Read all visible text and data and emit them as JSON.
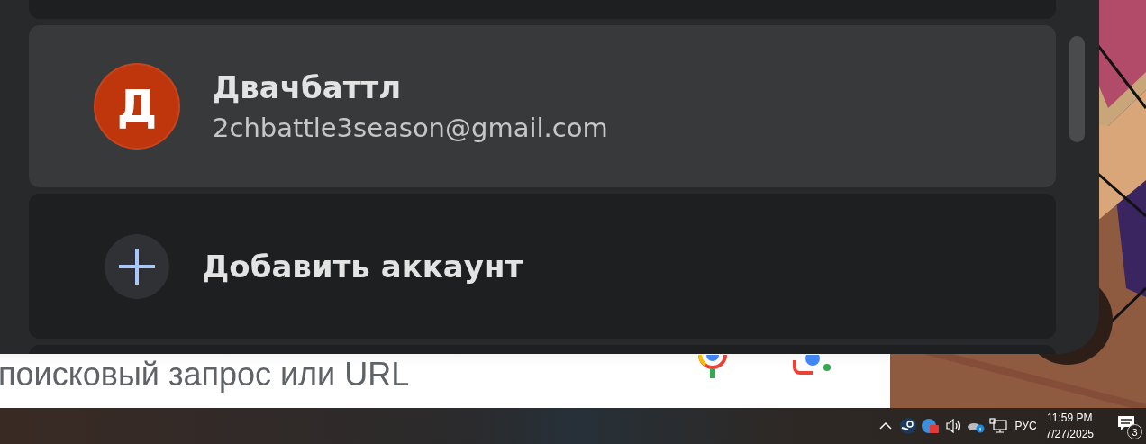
{
  "account_panel": {
    "accounts": [
      {
        "name": "Двачбаттл",
        "email": "2chbattle3season@gmail.com",
        "initial": "Д",
        "color": "#bf360c",
        "selected": true
      }
    ],
    "add_account": {
      "label": "Добавить аккаунт"
    }
  },
  "search": {
    "placeholder": "поисковый запрос или URL"
  },
  "taskbar": {
    "language": "РУС",
    "time": "11:59 PM",
    "date": "7/27/2025",
    "notifications": "3"
  }
}
